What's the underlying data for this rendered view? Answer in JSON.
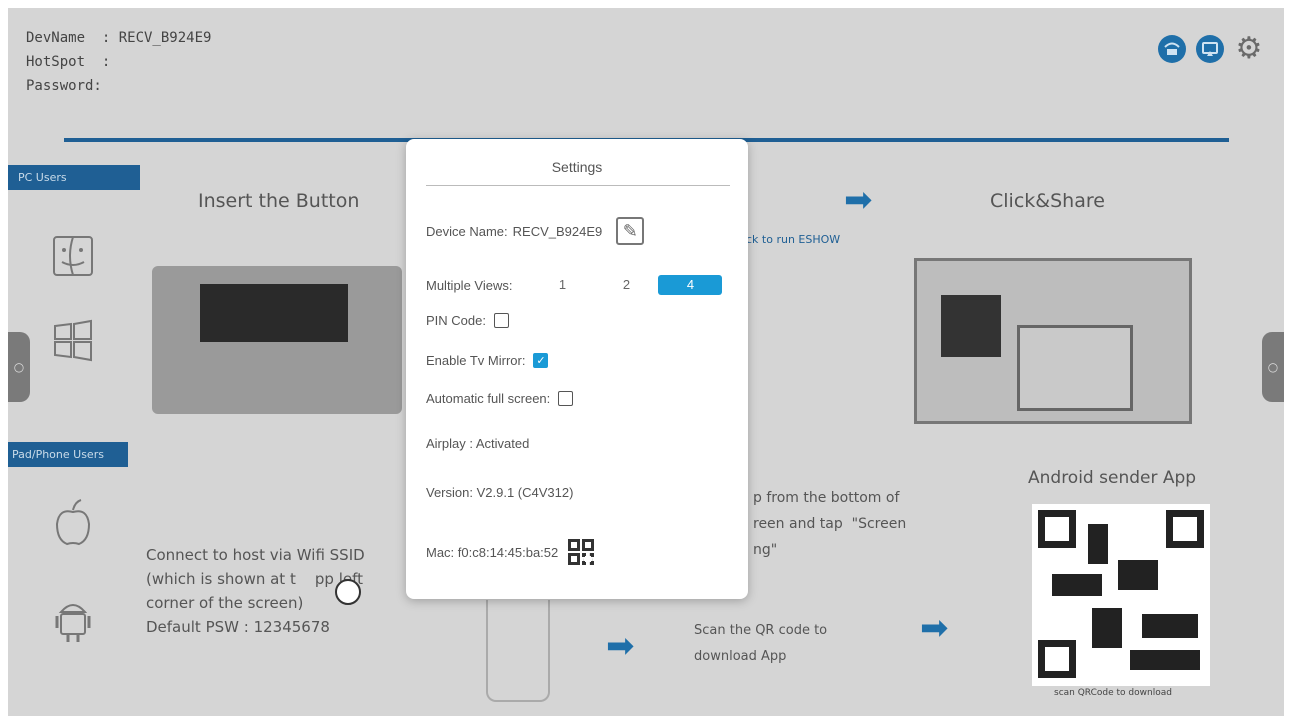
{
  "device": {
    "name_line": "DevName  : RECV_B924E9",
    "hotspot_line": "HotSpot  :",
    "password_line": "Password:"
  },
  "top_icons": [
    "network-icon",
    "cast-icon",
    "gear-icon"
  ],
  "tabs": {
    "pc_users": "PC Users",
    "pad_phone_users": "Pad/Phone Users"
  },
  "steps": {
    "insert_title": "Insert the Button",
    "click_share_title": "Click&Share",
    "click_run": "ck to run ESHOW",
    "android_title": "Android sender App",
    "scan_caption": "scan QRCode to download"
  },
  "connect_text": "Connect to host via Wifi SSID\n(which is shown at t    pp left\ncorner of the screen)\nDefault PSW : 12345678",
  "ios_text": "p from the bottom of\nreen and tap  \"Screen\nng\"",
  "scan_text": "Scan the QR code to\ndownload App",
  "settings": {
    "title": "Settings",
    "device_name_label": "Device Name:",
    "device_name_value": "RECV_B924E9",
    "multiple_views_label": "Multiple Views:",
    "views_options": [
      "1",
      "2",
      "4"
    ],
    "views_selected": "4",
    "pin_code_label": "PIN Code:",
    "pin_code_checked": false,
    "tv_mirror_label": "Enable Tv Mirror:",
    "tv_mirror_checked": true,
    "auto_full_label": "Automatic full screen:",
    "auto_full_checked": false,
    "airplay_text": "Airplay : Activated",
    "version_text": "Version:  V2.9.1 (C4V312)",
    "mac_text": "Mac:  f0:c8:14:45:ba:52"
  },
  "colors": {
    "accent": "#1a9ad6",
    "brand_dark": "#1f5f94"
  }
}
